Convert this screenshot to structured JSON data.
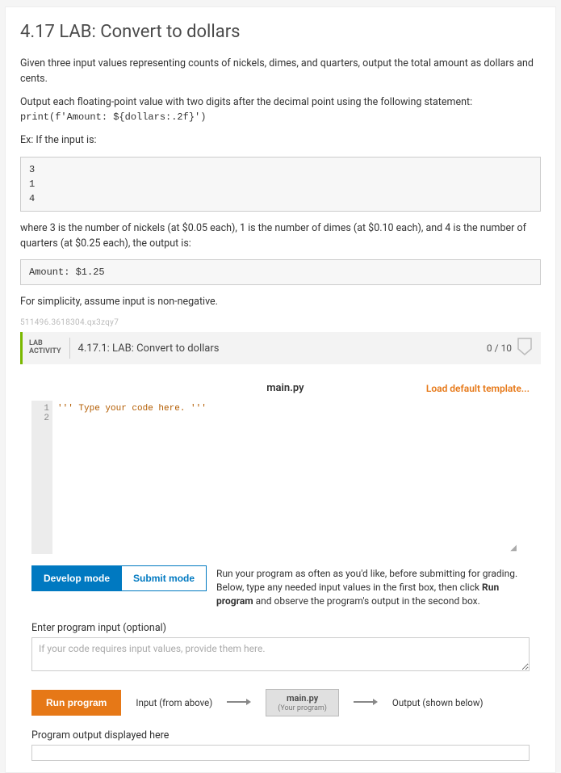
{
  "title": "4.17 LAB: Convert to dollars",
  "desc1": "Given three input values representing counts of nickels, dimes, and quarters, output the total amount as dollars and cents.",
  "desc2": "Output each floating-point value with two digits after the decimal point using the following statement:",
  "printStmt": "print(f'Amount: ${dollars:.2f}')",
  "exLabel": "Ex: If the input is:",
  "exInput": "3\n1\n4",
  "desc3": "where 3 is the number of nickels (at $0.05 each), 1 is the number of dimes (at $0.10 each), and 4 is the number of quarters (at $0.25 each), the output is:",
  "exOutput": "Amount: $1.25",
  "desc4": "For simplicity, assume input is non-negative.",
  "tinyId": "511496.3618304.qx3zqy7",
  "lab": {
    "labelTop": "LAB",
    "labelBottom": "ACTIVITY",
    "title": "4.17.1: LAB: Convert to dollars",
    "score": "0 / 10"
  },
  "editor": {
    "filename": "main.py",
    "loadTemplate": "Load default template...",
    "lines": [
      "1",
      "2"
    ],
    "code": "''' Type your code here. '''"
  },
  "modes": {
    "develop": "Develop mode",
    "submit": "Submit mode",
    "helpPrefix": "Run your program as often as you'd like, before submitting for grading. Below, type any needed input values in the first box, then click ",
    "helpBold": "Run program",
    "helpSuffix": " and observe the program's output in the second box."
  },
  "inputSection": {
    "label": "Enter program input (optional)",
    "placeholder": "If your code requires input values, provide them here."
  },
  "run": {
    "button": "Run program",
    "inputLabel": "Input (from above)",
    "boxMain": "main.py",
    "boxSub": "(Your program)",
    "outputLabel": "Output (shown below)"
  },
  "output": {
    "label": "Program output displayed here"
  }
}
